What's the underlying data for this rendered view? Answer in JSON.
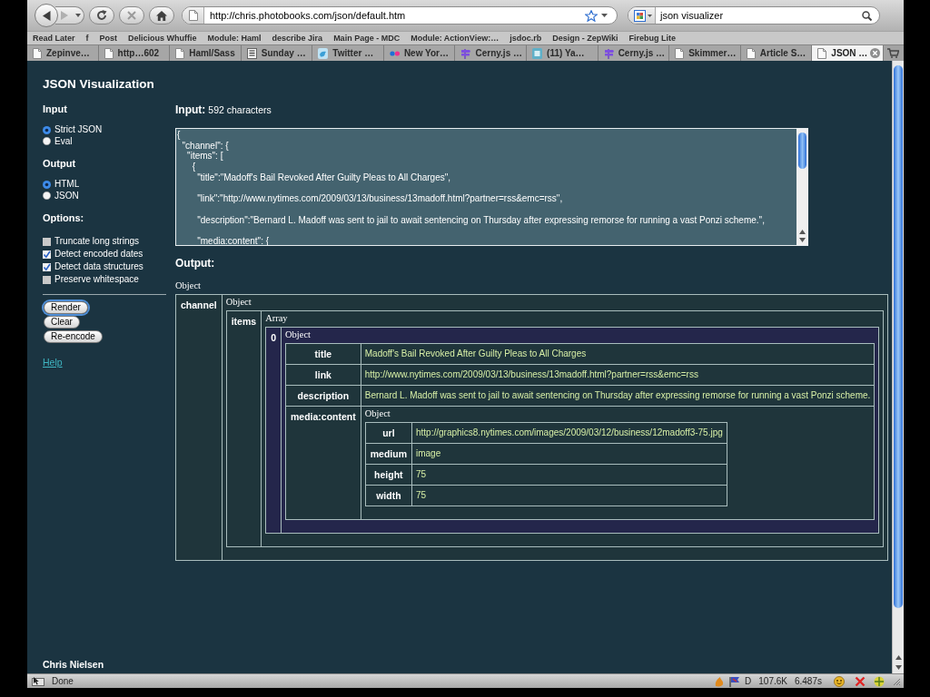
{
  "browser": {
    "url": "http://chris.photobooks.com/json/default.htm",
    "search": "json visualizer",
    "bookmarks": [
      "Read Later",
      "f",
      "Post",
      "Delicious Whuffie",
      "Module: Haml",
      "describe Jira",
      "Main Page - MDC",
      "Module: ActionView:…",
      "jsdoc.rb",
      "Design - ZepWiki",
      "Firebug Lite"
    ],
    "tabs": [
      {
        "label": "Zepinve…",
        "kind": "page",
        "selected": false
      },
      {
        "label": "http…602",
        "kind": "page",
        "selected": false
      },
      {
        "label": "Haml/Sass",
        "kind": "page",
        "selected": false
      },
      {
        "label": "Sunday …",
        "kind": "news",
        "selected": false
      },
      {
        "label": "Twitter …",
        "kind": "bird",
        "selected": false
      },
      {
        "label": "New Yor…",
        "kind": "dots",
        "selected": false
      },
      {
        "label": "Cerny.js …",
        "kind": "flag",
        "selected": false
      },
      {
        "label": "(11) Ya…",
        "kind": "tile",
        "selected": false
      },
      {
        "label": "Cerny.js …",
        "kind": "flag",
        "selected": false
      },
      {
        "label": "Skimmer…",
        "kind": "page",
        "selected": false
      },
      {
        "label": "Article S…",
        "kind": "page",
        "selected": false
      },
      {
        "label": "JSON …",
        "kind": "page",
        "selected": true
      }
    ]
  },
  "sidebar": {
    "title": "JSON Visualization",
    "groups": [
      {
        "heading": "Input",
        "kind": "radio",
        "items": [
          {
            "label": "Strict JSON",
            "selected": true
          },
          {
            "label": "Eval",
            "selected": false
          }
        ]
      },
      {
        "heading": "Output",
        "kind": "radio",
        "items": [
          {
            "label": "HTML",
            "selected": true
          },
          {
            "label": "JSON",
            "selected": false
          }
        ]
      },
      {
        "heading": "Options:",
        "kind": "checkbox",
        "items": [
          {
            "label": "Truncate long strings",
            "checked": false
          },
          {
            "label": "Detect encoded dates",
            "checked": true
          },
          {
            "label": "Detect data structures",
            "checked": true
          },
          {
            "label": "Preserve whitespace",
            "checked": false
          }
        ]
      }
    ],
    "buttons": [
      {
        "label": "Render",
        "focused": true
      },
      {
        "label": "Clear",
        "focused": false
      },
      {
        "label": "Re-encode",
        "focused": false
      }
    ],
    "help": "Help",
    "footer": "Chris Nielsen"
  },
  "input": {
    "heading": "Input:",
    "count": "592 characters",
    "value": "{\n  \"channel\": {\n    \"items\": [\n      {\n        \"title\":\"Madoff's Bail Revoked After Guilty Pleas to All Charges\",\n\n        \"link\":\"http://www.nytimes.com/2009/03/13/business/13madoff.html?partner=rss&emc=rss\",\n\n        \"description\":\"Bernard L. Madoff was sent to jail to await sentencing on Thursday after expressing remorse for running a vast Ponzi scheme.\",\n\n        \"media:content\": {"
  },
  "output": {
    "heading": "Output:",
    "tree": {
      "kind": "object",
      "label": "Object",
      "entries": [
        {
          "key": "channel",
          "node": {
            "kind": "object",
            "label": "Object",
            "entries": [
              {
                "key": "items",
                "node": {
                  "kind": "array",
                  "label": "Array",
                  "entries": [
                    {
                      "key": "0",
                      "node": {
                        "kind": "object",
                        "label": "Object",
                        "entries": [
                          {
                            "key": "title",
                            "value": "Madoff's Bail Revoked After Guilty Pleas to All Charges"
                          },
                          {
                            "key": "link",
                            "value": "http://www.nytimes.com/2009/03/13/business/13madoff.html?partner=rss&emc=rss"
                          },
                          {
                            "key": "description",
                            "value": "Bernard L. Madoff was sent to jail to await sentencing on Thursday after expressing remorse for running a vast Ponzi scheme."
                          },
                          {
                            "key": "media:content",
                            "node": {
                              "kind": "object",
                              "label": "Object",
                              "entries": [
                                {
                                  "key": "url",
                                  "value": "http://graphics8.nytimes.com/images/2009/03/12/business/12madoff3-75.jpg"
                                },
                                {
                                  "key": "medium",
                                  "value": "image"
                                },
                                {
                                  "key": "height",
                                  "value": "75"
                                },
                                {
                                  "key": "width",
                                  "value": "75"
                                }
                              ]
                            }
                          }
                        ]
                      }
                    }
                  ]
                }
              }
            ]
          }
        }
      ]
    }
  },
  "status_bar": {
    "text": "Done",
    "items": [
      "D",
      "107.6K",
      "6.487s"
    ]
  }
}
